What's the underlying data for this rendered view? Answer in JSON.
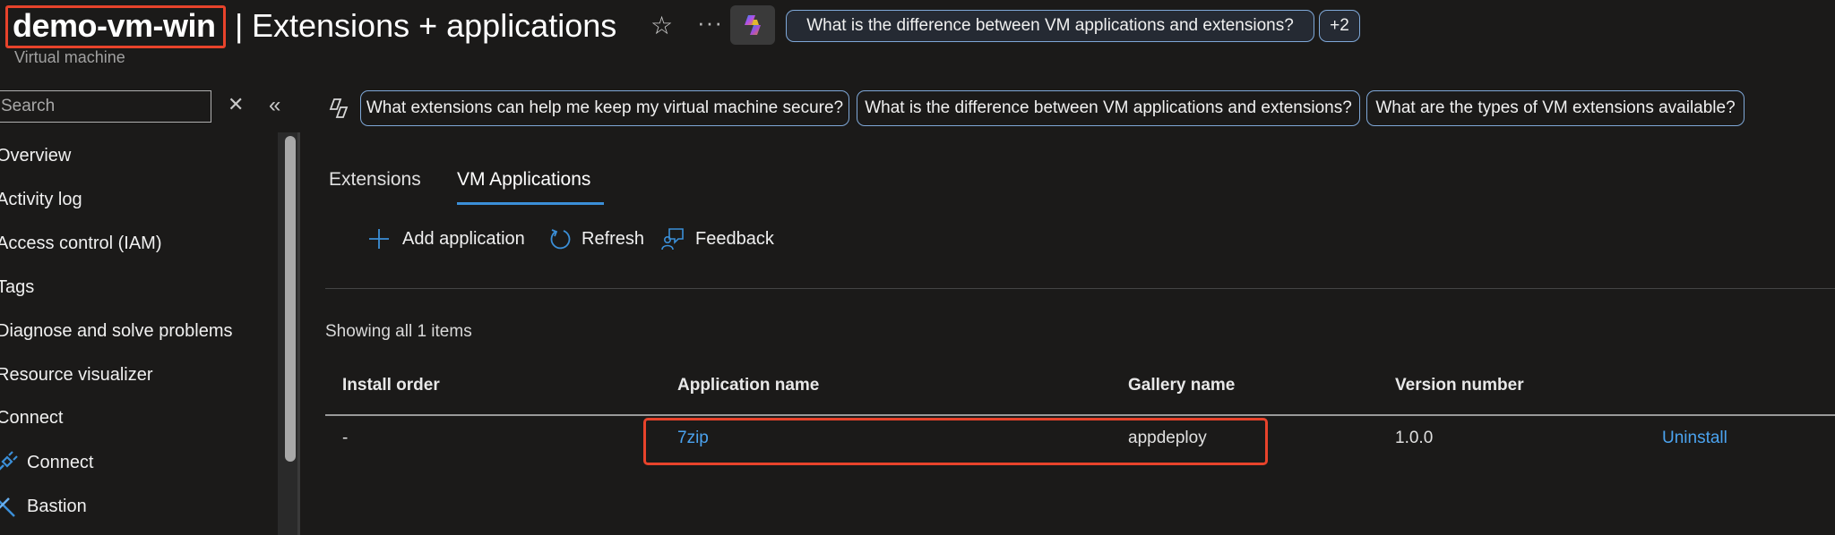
{
  "header": {
    "vm_name": "demo-vm-win",
    "separator": "|",
    "page_title": "Extensions + applications",
    "subtitle": "Virtual machine",
    "more_label": "···",
    "copilot_prompt": "What is the difference between VM applications and extensions?",
    "more_prompts": "+2"
  },
  "sidebar": {
    "search_placeholder": "Search",
    "items": [
      {
        "label": "Overview"
      },
      {
        "label": "Activity log"
      },
      {
        "label": "Access control (IAM)"
      },
      {
        "label": "Tags"
      },
      {
        "label": "Diagnose and solve problems"
      },
      {
        "label": "Resource visualizer"
      },
      {
        "label": "Connect"
      },
      {
        "label": "Connect",
        "icon": "plug-icon"
      },
      {
        "label": "Bastion",
        "icon": "bastion-icon"
      }
    ]
  },
  "prompts": [
    "What extensions can help me keep my virtual machine secure?",
    "What is the difference between VM applications and extensions?",
    "What are the types of VM extensions available?"
  ],
  "tabs": [
    {
      "label": "Extensions",
      "selected": false
    },
    {
      "label": "VM Applications",
      "selected": true
    }
  ],
  "commands": {
    "add": "Add application",
    "refresh": "Refresh",
    "feedback": "Feedback"
  },
  "table": {
    "summary": "Showing all 1 items",
    "columns": [
      "Install order",
      "Application name",
      "Gallery name",
      "Version number"
    ],
    "rows": [
      {
        "order": "-",
        "app": "7zip",
        "gallery": "appdeploy",
        "version": "1.0.0",
        "action": "Uninstall"
      }
    ]
  },
  "colors": {
    "accent": "#3b8fd8",
    "link": "#4ba3ef",
    "highlight": "#e8432b",
    "background": "#1b1a19"
  }
}
